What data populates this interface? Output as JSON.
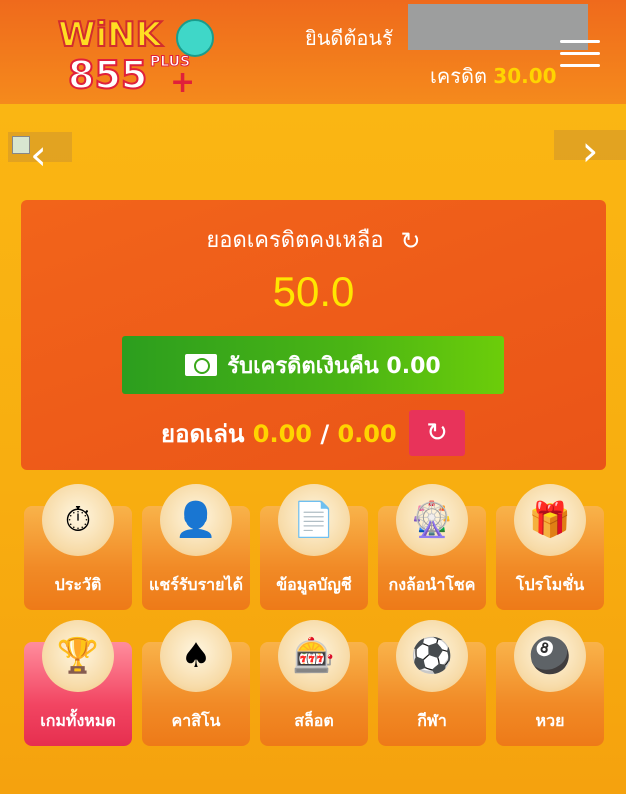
{
  "header": {
    "logo_text": "WINK 855 PLUS",
    "welcome": "ยินดีต้อนรั",
    "credit_label": "เครดิต",
    "credit_amount": "30.00"
  },
  "banner": {
    "prev_glyph": "‹",
    "next_glyph": "›"
  },
  "balance_card": {
    "title": "ยอดเครดิตคงเหลือ",
    "balance": "50.0",
    "cashback_label": "รับเครดิตเงินคืน 0.00",
    "turnover_label": "ยอดเล่น",
    "turnover_current": "0.00",
    "turnover_separator": "/",
    "turnover_target": "0.00"
  },
  "menu": {
    "row1": [
      {
        "label": "ประวัติ",
        "icon": "stopwatch-icon"
      },
      {
        "label": "แชร์รับรายได้",
        "icon": "user-icon"
      },
      {
        "label": "ข้อมูลบัญชี",
        "icon": "document-icon"
      },
      {
        "label": "กงล้อนำโชค",
        "icon": "wheel-icon"
      },
      {
        "label": "โปรโมชั่น",
        "icon": "gift-icon"
      }
    ],
    "row2": [
      {
        "label": "เกมทั้งหมด",
        "icon": "trophy-icon"
      },
      {
        "label": "คาสิโน",
        "icon": "card-icon"
      },
      {
        "label": "สล็อต",
        "icon": "slot-machine-icon"
      },
      {
        "label": "กีฬา",
        "icon": "ball-icon"
      },
      {
        "label": "หวย",
        "icon": "lottery-icon"
      }
    ]
  },
  "colors": {
    "header": "#ef6a1c",
    "background": "#fbb814",
    "card": "#f2641a",
    "balance": "#ffe600",
    "cashback_button": "#4bb514",
    "refresh_button": "#e8335a",
    "active_tile": "#f24562"
  }
}
